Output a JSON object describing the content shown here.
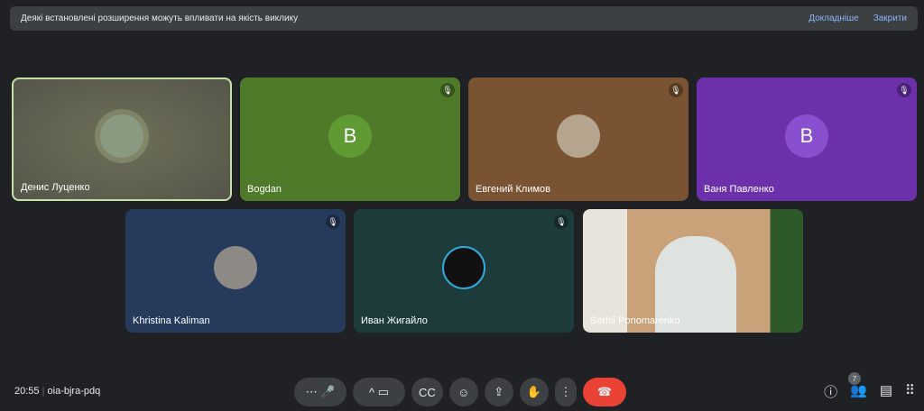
{
  "banner": {
    "message": "Деякі встановлені розширення можуть впливати на якість виклику",
    "learn_more": "Докладніше",
    "close": "Закрити"
  },
  "participants": [
    {
      "name": "Денис Луценко",
      "initial": "",
      "muted": false,
      "color": "#5e5f4a"
    },
    {
      "name": "Bogdan",
      "initial": "B",
      "muted": true,
      "color": "#4e7a2a"
    },
    {
      "name": "Евгений Климов",
      "initial": "",
      "muted": true,
      "color": "#7a5432"
    },
    {
      "name": "Ваня Павленко",
      "initial": "B",
      "muted": true,
      "color": "#6b30aa"
    },
    {
      "name": "Khristina Kaliman",
      "initial": "",
      "muted": true,
      "color": "#263a5c"
    },
    {
      "name": "Иван Жигайло",
      "initial": "",
      "muted": true,
      "color": "#1e3b3b"
    },
    {
      "name": "Serhii Ponomarenko",
      "initial": "",
      "muted": false,
      "color": "#c9a27a"
    }
  ],
  "footer": {
    "time": "20:55",
    "meeting_code": "oia-bjra-pdq",
    "people_count": "7"
  }
}
